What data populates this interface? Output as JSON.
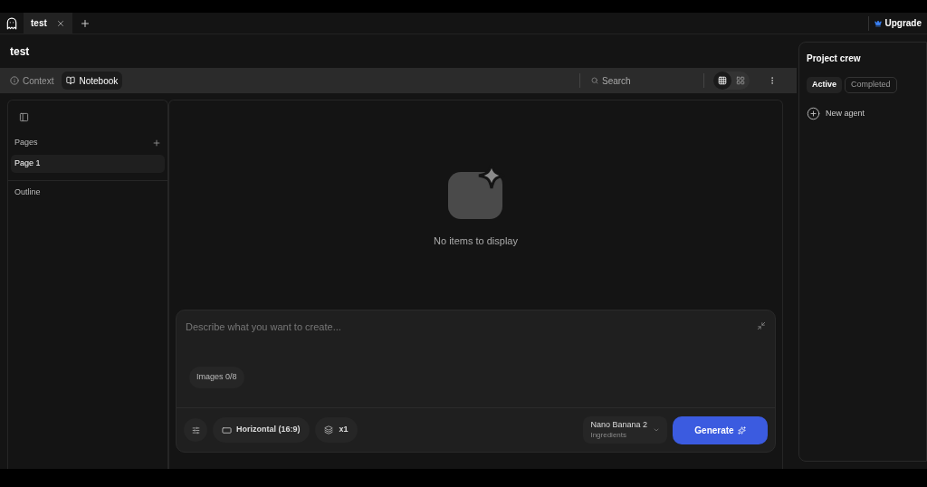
{
  "tabs": [
    {
      "label": "test",
      "selected": true
    }
  ],
  "upgrade": "Upgrade",
  "page_title": "test",
  "view_tabs": [
    {
      "label": "Context",
      "selected": false
    },
    {
      "label": "Notebook",
      "selected": true
    }
  ],
  "search": {
    "placeholder": "Search"
  },
  "view_modes": [
    {
      "kind": "grid",
      "selected": true
    },
    {
      "kind": "gallery",
      "selected": false
    }
  ],
  "sidebar": {
    "pages_label": "Pages",
    "pages": [
      {
        "label": "Page 1",
        "selected": true
      }
    ],
    "outline_label": "Outline"
  },
  "empty_state": "No items to display",
  "composer": {
    "placeholder": "Describe what you want to create...",
    "images": "Images 0/8",
    "aspect": "Horizontal (16:9)",
    "count": "x1",
    "model": {
      "name": "Nano Banana 2",
      "subtitle": "Ingredients"
    },
    "generate": "Generate"
  },
  "crew": {
    "title": "Project crew",
    "tabs": [
      {
        "label": "Active",
        "selected": true
      },
      {
        "label": "Completed",
        "selected": false
      }
    ],
    "new_agent": "New agent"
  }
}
